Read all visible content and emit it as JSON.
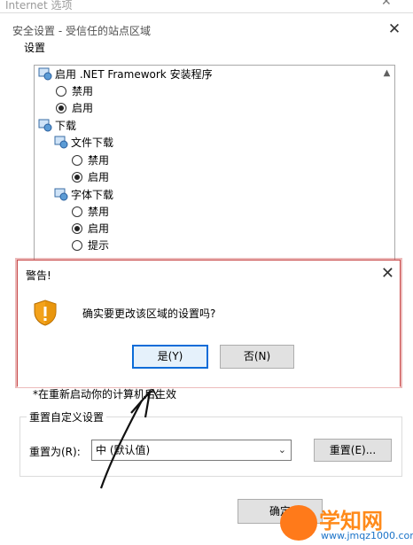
{
  "background_window": {
    "title": "Internet 选项",
    "close_glyph": "✕"
  },
  "dialog": {
    "title": "安全设置 - 受信任的站点区域",
    "close_glyph": "✕",
    "settings_label": "设置",
    "tree": [
      {
        "kind": "node",
        "label": "启用 .NET Framework 安装程序"
      },
      {
        "kind": "radio",
        "label": "禁用",
        "checked": false
      },
      {
        "kind": "radio",
        "label": "启用",
        "checked": true
      },
      {
        "kind": "node",
        "label": "下载"
      },
      {
        "kind": "node",
        "label": "文件下载"
      },
      {
        "kind": "radio",
        "label": "禁用",
        "checked": false
      },
      {
        "kind": "radio",
        "label": "启用",
        "checked": true
      },
      {
        "kind": "node",
        "label": "字体下载"
      },
      {
        "kind": "radio",
        "label": "禁用",
        "checked": false
      },
      {
        "kind": "radio",
        "label": "启用",
        "checked": true
      },
      {
        "kind": "radio",
        "label": "提示",
        "checked": false
      }
    ],
    "note": "*在重新启动你的计算机后生效",
    "reset_group": {
      "title": "重置自定义设置",
      "label": "重置为(R):",
      "selected": "中 (默认值)",
      "reset_button": "重置(E)..."
    },
    "ok_button": "确定"
  },
  "alert": {
    "title": "警告!",
    "close_glyph": "✕",
    "message": "确实要更改该区域的设置吗?",
    "yes_button": "是(Y)",
    "no_button": "否(N)"
  },
  "watermark": {
    "text": "学知网",
    "url": "www.jmqz1000.com"
  },
  "colors": {
    "alert_border": "#c84a4a",
    "default_button_border": "#0a6cd8",
    "watermark_orange": "#ff8a1a"
  }
}
